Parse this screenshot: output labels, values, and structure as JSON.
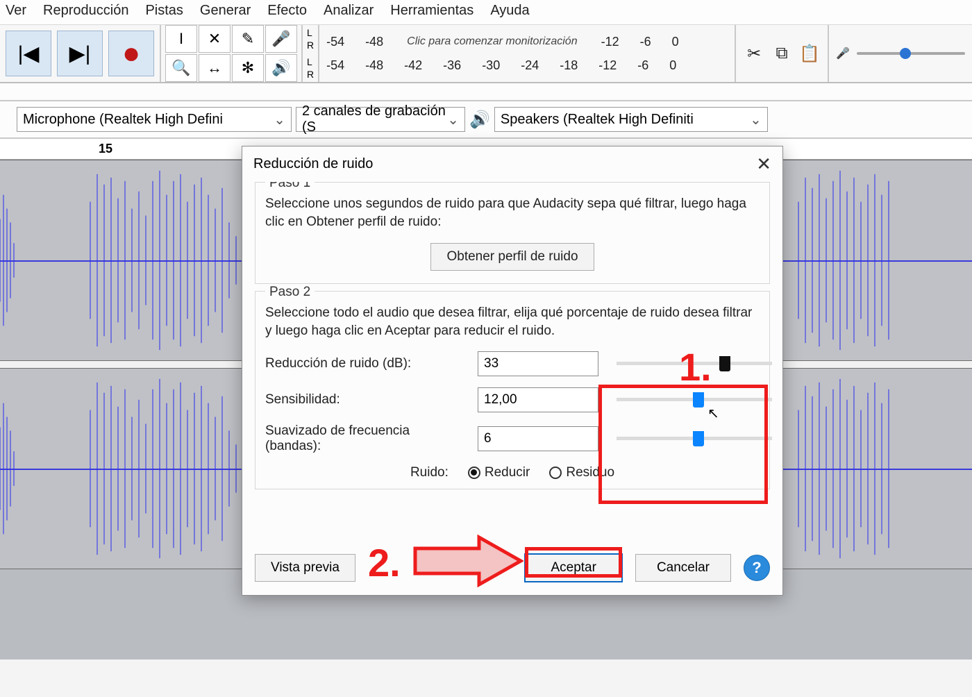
{
  "menu": {
    "items": [
      "Ver",
      "Reproducción",
      "Pistas",
      "Generar",
      "Efecto",
      "Analizar",
      "Herramientas",
      "Ayuda"
    ]
  },
  "transport": {
    "prev": "|◀",
    "next": "▶|",
    "record": "●"
  },
  "tools": {
    "grid": [
      "I",
      "✕",
      "✎",
      "🎤",
      "🔍",
      "↔",
      "✻",
      "🔊"
    ]
  },
  "lr": {
    "l": "L",
    "r": "R"
  },
  "meter": {
    "ticks": [
      "-54",
      "-48",
      "-42",
      "-36",
      "-30",
      "-24",
      "-18",
      "-12",
      "-6",
      "0"
    ],
    "hint": "Clic para comenzar monitorización"
  },
  "edit_icons": {
    "cut": "✂",
    "copy": "⧉",
    "paste": "📋"
  },
  "playback_icon": "🎤",
  "devices": {
    "input": "Microphone (Realtek High Defini",
    "channels": "2 canales de grabación (S",
    "output": "Speakers (Realtek High Definiti"
  },
  "ruler": {
    "mark15": "15"
  },
  "dialog": {
    "title": "Reducción de ruido",
    "step1_legend": "Paso 1",
    "step1_text": "Seleccione unos segundos de ruido para que Audacity sepa qué filtrar, luego haga clic en Obtener perfil de ruido:",
    "profile_btn": "Obtener perfil de ruido",
    "step2_legend": "Paso 2",
    "step2_text": "Seleccione todo el audio que desea filtrar, elija qué porcentaje de ruido desea filtrar y luego haga clic en Aceptar para reducir el ruido.",
    "params": {
      "reduction_label": "Reducción de ruido (dB):",
      "reduction_value": "33",
      "sensitivity_label": "Sensibilidad:",
      "sensitivity_value": "12,00",
      "smoothing_label": "Suavizado de frecuencia (bandas):",
      "smoothing_value": "6"
    },
    "noise_label": "Ruido:",
    "radio_reduce": "Reducir",
    "radio_residue": "Residuo",
    "preview": "Vista previa",
    "accept": "Aceptar",
    "cancel": "Cancelar",
    "help": "?"
  },
  "annotations": {
    "one": "1.",
    "two": "2."
  }
}
